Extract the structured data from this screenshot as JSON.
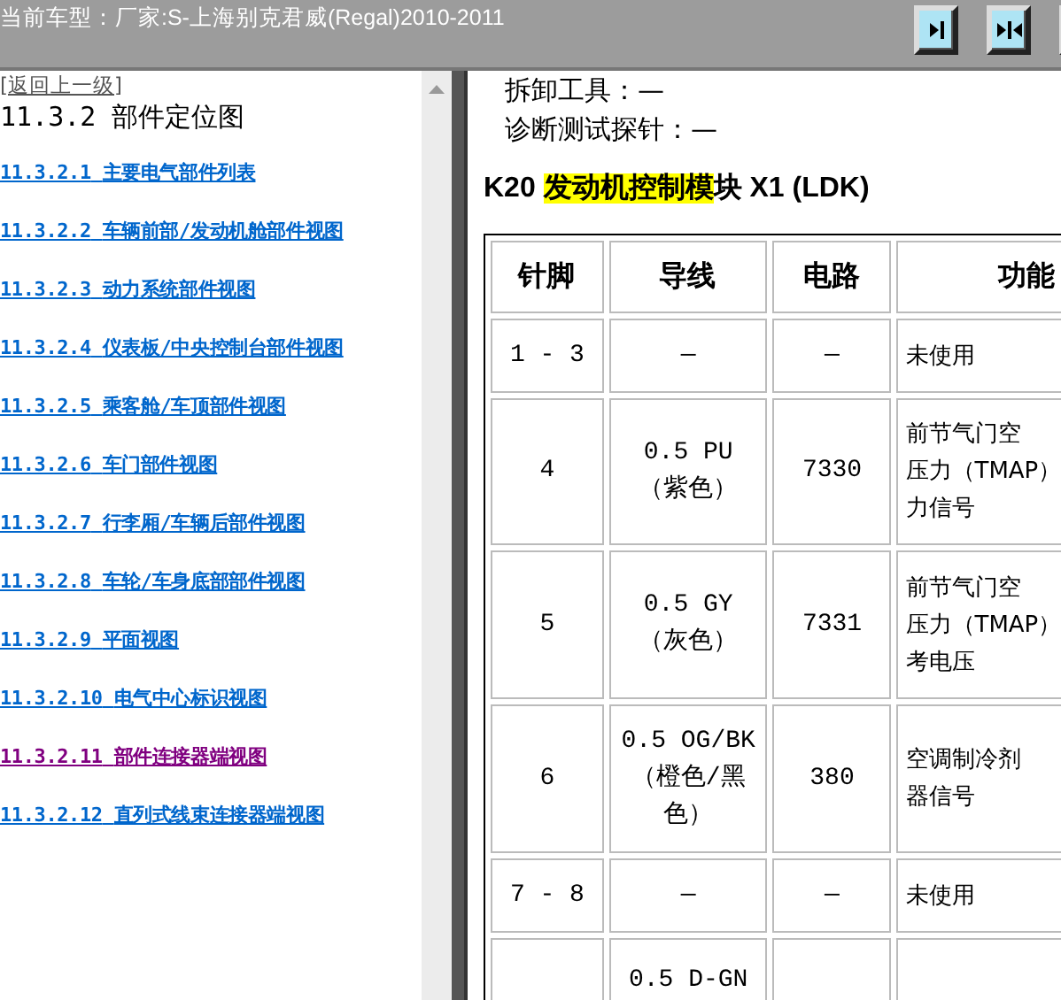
{
  "top_bar": {
    "title": "当前车型：厂家:S-上海别克君威(Regal)2010-2011",
    "buttons": [
      {
        "kind": "right"
      },
      {
        "kind": "inward"
      },
      {
        "kind": "other"
      }
    ]
  },
  "sidebar": {
    "back_link": "[返回上一级]",
    "heading": "11.3.2 部件定位图",
    "items": [
      {
        "number": "11.3.2.1",
        "label": "主要电气部件列表",
        "visited": false
      },
      {
        "number": "11.3.2.2",
        "label": "车辆前部/发动机舱部件视图",
        "visited": false
      },
      {
        "number": "11.3.2.3",
        "label": "动力系统部件视图",
        "visited": false
      },
      {
        "number": "11.3.2.4",
        "label": "仪表板/中央控制台部件视图",
        "visited": false
      },
      {
        "number": "11.3.2.5",
        "label": "乘客舱/车顶部件视图",
        "visited": false
      },
      {
        "number": "11.3.2.6",
        "label": "车门部件视图",
        "visited": false
      },
      {
        "number": "11.3.2.7",
        "label": "行李厢/车辆后部件视图",
        "visited": false
      },
      {
        "number": "11.3.2.8",
        "label": "车轮/车身底部部件视图",
        "visited": false
      },
      {
        "number": "11.3.2.9",
        "label": "平面视图",
        "visited": false
      },
      {
        "number": "11.3.2.10",
        "label": "电气中心标识视图",
        "visited": false
      },
      {
        "number": "11.3.2.11",
        "label": "部件连接器端视图",
        "visited": true
      },
      {
        "number": "11.3.2.12",
        "label": "直列式线束连接器端视图",
        "visited": false
      }
    ]
  },
  "content": {
    "notes": [
      "拆卸工具：—",
      "诊断测试探针：—"
    ],
    "heading": [
      {
        "text": "K20 ",
        "highlight": false
      },
      {
        "text": "发动机控制模",
        "highlight": true
      },
      {
        "text": "块  X1 (LDK)",
        "highlight": false
      }
    ],
    "table": {
      "columns": [
        "针脚",
        "导线",
        "电路",
        "功能"
      ],
      "rows": [
        {
          "pin": "1 - 3",
          "wire": [
            "—"
          ],
          "circuit": "—",
          "function": [
            "未使用"
          ]
        },
        {
          "pin": "4",
          "wire": [
            "0.5 PU",
            "（紫色）"
          ],
          "circuit": "7330",
          "function": [
            "前节气门空",
            "压力（TMAP）",
            "力信号"
          ]
        },
        {
          "pin": "5",
          "wire": [
            "0.5 GY",
            "（灰色）"
          ],
          "circuit": "7331",
          "function": [
            "前节气门空",
            "压力（TMAP）",
            "考电压"
          ]
        },
        {
          "pin": "6",
          "wire": [
            "0.5 OG/BK",
            "（橙色/黑",
            "色）"
          ],
          "circuit": "380",
          "function": [
            "空调制冷剂",
            "器信号"
          ]
        },
        {
          "pin": "7 - 8",
          "wire": [
            "—"
          ],
          "circuit": "—",
          "function": [
            "未使用"
          ]
        },
        {
          "pin": "",
          "wire": [
            "0.5 D-GN"
          ],
          "circuit": "",
          "function": []
        }
      ]
    }
  }
}
